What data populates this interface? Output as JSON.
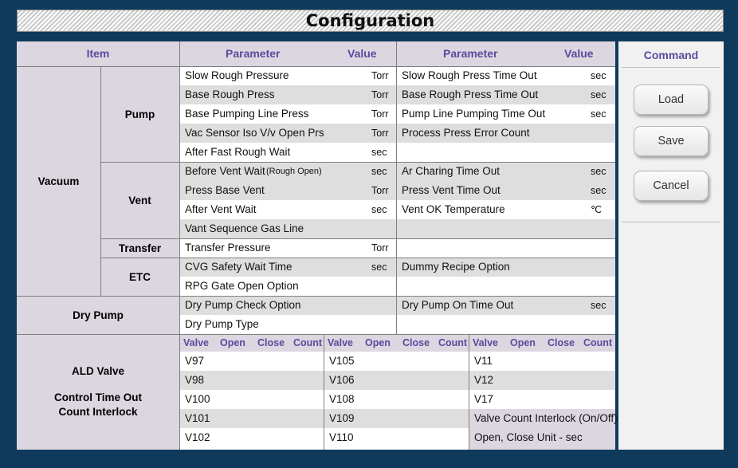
{
  "title": "Configuration",
  "header": {
    "item": "Item",
    "parameter_left": "Parameter",
    "value_left": "Value",
    "parameter_right": "Parameter",
    "value_right": "Value"
  },
  "categories": {
    "vacuum": "Vacuum",
    "pump": "Pump",
    "vent": "Vent",
    "transfer": "Transfer",
    "etc": "ETC",
    "dry_pump": "Dry Pump",
    "ald_valve": "ALD Valve",
    "control_time_out": "Control Time Out",
    "count_interlock": "Count Interlock"
  },
  "left_rows": [
    {
      "label": "Slow Rough Pressure",
      "unit": "Torr"
    },
    {
      "label": "Base Rough Press",
      "unit": "Torr"
    },
    {
      "label": "Base Pumping Line Press",
      "unit": "Torr"
    },
    {
      "label": "Vac Sensor Iso V/v Open Prs",
      "unit": "Torr"
    },
    {
      "label": "After Fast Rough Wait",
      "unit": "sec"
    },
    {
      "label": "Before Vent Wait",
      "note": "(Rough Open)",
      "unit": "sec"
    },
    {
      "label": "Press Base Vent",
      "unit": "Torr"
    },
    {
      "label": "After Vent Wait",
      "unit": "sec"
    },
    {
      "label": "Vant Sequence Gas Line",
      "unit": ""
    },
    {
      "label": "Transfer Pressure",
      "unit": "Torr"
    },
    {
      "label": "CVG Safety Wait Time",
      "unit": "sec"
    },
    {
      "label": "RPG Gate Open Option",
      "unit": ""
    },
    {
      "label": "Dry Pump Check Option",
      "unit": ""
    },
    {
      "label": "Dry Pump Type",
      "unit": ""
    }
  ],
  "right_rows": [
    {
      "label": "Slow Rough Press Time Out",
      "unit": "sec"
    },
    {
      "label": "Base Rough Press Time Out",
      "unit": "sec"
    },
    {
      "label": "Pump Line Pumping Time Out",
      "unit": "sec"
    },
    {
      "label": "Process Press Error Count",
      "unit": ""
    },
    {
      "label": "",
      "unit": ""
    },
    {
      "label": "Ar Charing Time Out",
      "unit": "sec"
    },
    {
      "label": "Press Vent Time Out",
      "unit": "sec"
    },
    {
      "label": "Vent OK Temperature",
      "unit": "℃"
    },
    {
      "label": "",
      "unit": ""
    },
    {
      "label": "",
      "unit": ""
    },
    {
      "label": "Dummy Recipe Option",
      "unit": ""
    },
    {
      "label": "",
      "unit": ""
    },
    {
      "label": "Dry Pump On Time Out",
      "unit": "sec"
    },
    {
      "label": "",
      "unit": ""
    }
  ],
  "valve_header": {
    "valve": "Valve",
    "open": "Open",
    "close": "Close",
    "count": "Count"
  },
  "valve_col1": [
    "V97",
    "V98",
    "V100",
    "V101",
    "V102"
  ],
  "valve_col2": [
    "V105",
    "V106",
    "V108",
    "V109",
    "V110"
  ],
  "valve_col3": [
    "V11",
    "V12",
    "V17",
    "Valve Count Interlock (On/Off)",
    "Open, Close Unit - sec"
  ],
  "command": {
    "title": "Command",
    "load": "Load",
    "save": "Save",
    "cancel": "Cancel"
  }
}
